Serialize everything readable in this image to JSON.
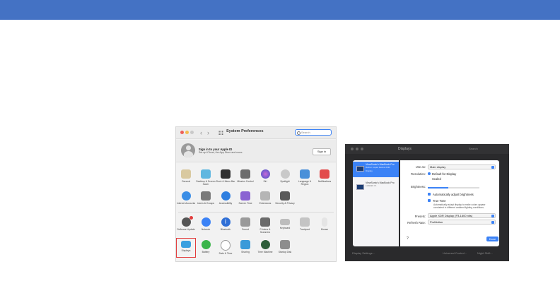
{
  "accent": "#3b82f6",
  "banner_color": "#4472c4",
  "system_preferences": {
    "title": "System Preferences",
    "search_placeholder": "Search",
    "apple_id_title": "Sign in to your Apple ID",
    "apple_id_subtitle": "Set up iCloud, the App Store and more.",
    "sign_in_button": "Sign in",
    "row1": [
      "General",
      "Desktop & Screen Saver",
      "Dock & Menu Bar",
      "Mission Control",
      "Siri",
      "Spotlight",
      "Language & Region",
      "Notifications"
    ],
    "row2": [
      "Internet Accounts",
      "Users & Groups",
      "Accessibility",
      "Screen Time",
      "Extensions",
      "Security & Privacy"
    ],
    "row3": [
      "Software Update",
      "Network",
      "Bluetooth",
      "Sound",
      "Printers & Scanners",
      "Keyboard",
      "Trackpad",
      "Mouse"
    ],
    "row4": [
      "Displays",
      "Battery",
      "Date & Time",
      "Sharing",
      "Time Machine",
      "Startup Disk"
    ]
  },
  "displays": {
    "title": "Displays",
    "search": "Search",
    "devices": [
      {
        "name": "ViewSonic's MacBook Pro",
        "sub": "Built-in Liquid Retina XDR Display"
      },
      {
        "name": "ViewSonic's MacBook Pro",
        "sub": "LG6K26 Y1"
      }
    ],
    "use_as_label": "Use as:",
    "use_as_value": "Main display",
    "resolution_label": "Resolution:",
    "resolution_default": "Default for Display",
    "resolution_scaled": "Scaled",
    "brightness_label": "Brightness:",
    "brightness_level": 0.4,
    "auto_brightness": "Automatically adjust brightness",
    "true_tone": "True Tone",
    "true_tone_desc": "Automatically adapt display to make colors appear consistent in different ambient lighting conditions.",
    "presets_label": "Presets:",
    "presets_value": "Apple XDR Display (P3-1600 nits)",
    "refresh_label": "Refresh Rate:",
    "refresh_value": "ProMotion",
    "help": "?",
    "done_button": "Done",
    "footer_left": "Display Settings...",
    "footer_mid": "Universal Control...",
    "footer_right": "Night Shift..."
  }
}
